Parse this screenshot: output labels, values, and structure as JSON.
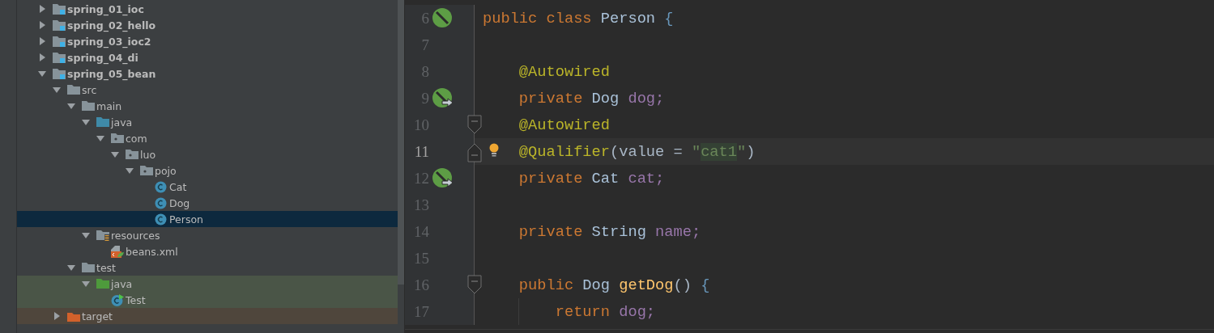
{
  "project_tree": [
    {
      "label": "spring_01_ioc",
      "kind": "module",
      "expanded": false,
      "selected": false
    },
    {
      "label": "spring_02_hello",
      "kind": "module",
      "expanded": false,
      "selected": false
    },
    {
      "label": "spring_03_ioc2",
      "kind": "module",
      "expanded": false,
      "selected": false
    },
    {
      "label": "spring_04_di",
      "kind": "module",
      "expanded": false,
      "selected": false
    },
    {
      "label": "spring_05_bean",
      "kind": "module",
      "expanded": true,
      "selected": false,
      "children": [
        {
          "label": "src",
          "kind": "folder",
          "expanded": true,
          "selected": false,
          "children": [
            {
              "label": "main",
              "kind": "folder",
              "expanded": true,
              "selected": false,
              "children": [
                {
                  "label": "java",
                  "kind": "source-folder",
                  "expanded": true,
                  "selected": false,
                  "children": [
                    {
                      "label": "com",
                      "kind": "package",
                      "expanded": true,
                      "selected": false,
                      "children": [
                        {
                          "label": "luo",
                          "kind": "package",
                          "expanded": true,
                          "selected": false,
                          "children": [
                            {
                              "label": "pojo",
                              "kind": "package",
                              "expanded": true,
                              "selected": false,
                              "children": [
                                {
                                  "label": "Cat",
                                  "kind": "class",
                                  "selected": false
                                },
                                {
                                  "label": "Dog",
                                  "kind": "class",
                                  "selected": false
                                },
                                {
                                  "label": "Person",
                                  "kind": "class",
                                  "selected": true
                                }
                              ]
                            }
                          ]
                        }
                      ]
                    }
                  ]
                },
                {
                  "label": "resources",
                  "kind": "resources",
                  "expanded": true,
                  "selected": false,
                  "children": [
                    {
                      "label": "beans.xml",
                      "kind": "xml",
                      "selected": false
                    }
                  ]
                }
              ]
            },
            {
              "label": "test",
              "kind": "folder",
              "expanded": true,
              "selected": false,
              "children": [
                {
                  "label": "java",
                  "kind": "test-folder",
                  "color": "#4a5547",
                  "expanded": true,
                  "selected": false,
                  "children": [
                    {
                      "label": "Test",
                      "kind": "test-class",
                      "color": "#4a5547",
                      "selected": false
                    }
                  ]
                }
              ]
            }
          ]
        },
        {
          "label": "target",
          "kind": "excluded-folder",
          "color": "#4f463c",
          "expanded": false,
          "selected": false
        }
      ]
    }
  ],
  "editor": {
    "lines": [
      {
        "number": "6",
        "current": false,
        "gutter": {
          "kind": "bean"
        },
        "kind": "top",
        "tokens": [
          {
            "kind": "keyword",
            "text": "public"
          },
          {
            "kind": "keyword",
            "text": "class",
            "gap": true
          },
          {
            "kind": "type",
            "text": "Person",
            "gap": true
          },
          {
            "kind": "brace",
            "text": "{",
            "gap": true
          }
        ]
      },
      {
        "number": "7",
        "current": false
      },
      {
        "number": "8",
        "current": false,
        "kind": "member",
        "tokens": [
          {
            "kind": "annotation",
            "text": "@Autowired"
          }
        ]
      },
      {
        "number": "9",
        "current": false,
        "gutter": {
          "kind": "autowired"
        },
        "kind": "member",
        "tokens": [
          {
            "kind": "keyword",
            "text": "private"
          },
          {
            "kind": "type",
            "text": "Dog",
            "gap": true
          },
          {
            "kind": "field",
            "text": "dog;",
            "gap": true
          }
        ]
      },
      {
        "number": "10",
        "current": false,
        "fold": {
          "kind": "start"
        },
        "kind": "member",
        "tokens": [
          {
            "kind": "annotation",
            "text": "@Autowired"
          }
        ]
      },
      {
        "number": "11",
        "current": true,
        "fold": {
          "kind": "end"
        },
        "bulb": true,
        "kind": "member",
        "tokens": [
          {
            "kind": "annotation",
            "text": "@Qualifier"
          },
          {
            "kind": "plain",
            "text": "(value ="
          },
          {
            "kind": "string",
            "text": "\"",
            "gap": true
          },
          {
            "kind": "string-highlighted",
            "text": "cat1"
          },
          {
            "kind": "string",
            "text": "\""
          },
          {
            "kind": "plain",
            "text": ")"
          }
        ]
      },
      {
        "number": "12",
        "current": false,
        "gutter": {
          "kind": "autowired"
        },
        "kind": "member",
        "tokens": [
          {
            "kind": "keyword",
            "text": "private"
          },
          {
            "kind": "type",
            "text": "Cat",
            "gap": true
          },
          {
            "kind": "field",
            "text": "cat;",
            "gap": true
          }
        ]
      },
      {
        "number": "13",
        "current": false
      },
      {
        "number": "14",
        "current": false,
        "kind": "member",
        "tokens": [
          {
            "kind": "keyword",
            "text": "private"
          },
          {
            "kind": "type",
            "text": "String",
            "gap": true
          },
          {
            "kind": "field",
            "text": "name;",
            "gap": true
          }
        ]
      },
      {
        "number": "15",
        "current": false
      },
      {
        "number": "16",
        "current": false,
        "fold": {
          "kind": "start"
        },
        "kind": "member",
        "tokens": [
          {
            "kind": "keyword",
            "text": "public"
          },
          {
            "kind": "type",
            "text": "Dog",
            "gap": true
          },
          {
            "kind": "method",
            "text": "getDog",
            "gap": true
          },
          {
            "kind": "plain",
            "text": "()"
          },
          {
            "kind": "brace",
            "text": "{",
            "gap": true
          }
        ]
      },
      {
        "number": "17",
        "current": false,
        "kind": "body",
        "tokens": [
          {
            "kind": "keyword",
            "text": "return"
          },
          {
            "kind": "field",
            "text": "dog;",
            "gap": true
          }
        ]
      }
    ]
  }
}
